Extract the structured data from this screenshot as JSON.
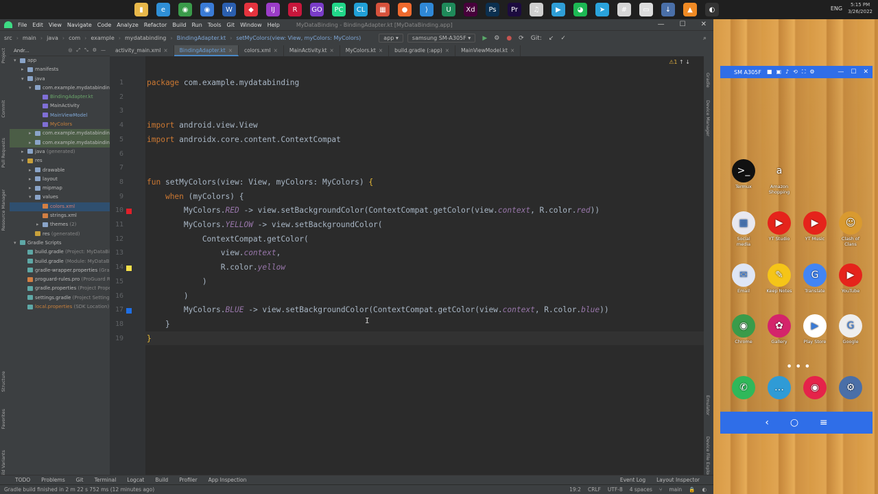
{
  "taskbar": {
    "icons": [
      {
        "name": "folder-icon",
        "color": "#e8b84a",
        "glyph": "▮"
      },
      {
        "name": "edge-icon",
        "color": "#2f8fd6",
        "glyph": "e"
      },
      {
        "name": "chrome-icon",
        "color": "#3a9b4a",
        "glyph": "◉"
      },
      {
        "name": "chrome-beta-icon",
        "color": "#3a7bd6",
        "glyph": "◉"
      },
      {
        "name": "word-icon",
        "color": "#2b5fb0",
        "glyph": "W"
      },
      {
        "name": "app-red-icon",
        "color": "#e5333e",
        "glyph": "◆"
      },
      {
        "name": "intellij-icon",
        "color": "#9b3cc8",
        "glyph": "IJ"
      },
      {
        "name": "rider-icon",
        "color": "#c8173c",
        "glyph": "R"
      },
      {
        "name": "goland-icon",
        "color": "#7a3cc8",
        "glyph": "GO"
      },
      {
        "name": "pycharm-icon",
        "color": "#21d789",
        "glyph": "PC"
      },
      {
        "name": "clion-icon",
        "color": "#21a0d7",
        "glyph": "CL"
      },
      {
        "name": "photos-icon",
        "color": "#d7523c",
        "glyph": "▦"
      },
      {
        "name": "postman-icon",
        "color": "#f06a2e",
        "glyph": "●"
      },
      {
        "name": "vscode-icon",
        "color": "#2f88d6",
        "glyph": "⟩"
      },
      {
        "name": "upwork-icon",
        "color": "#1f8a5a",
        "glyph": "U"
      },
      {
        "name": "xd-icon",
        "color": "#47003b",
        "glyph": "Xd"
      },
      {
        "name": "photoshop-icon",
        "color": "#0b2f4f",
        "glyph": "Ps"
      },
      {
        "name": "premiere-icon",
        "color": "#1c0b3f",
        "glyph": "Pr"
      },
      {
        "name": "itunes-icon",
        "color": "#cfcfcf",
        "glyph": "♫"
      },
      {
        "name": "media-player-icon",
        "color": "#2f9ed6",
        "glyph": "▶"
      },
      {
        "name": "spotify-icon",
        "color": "#1db954",
        "glyph": "◕"
      },
      {
        "name": "telegram-icon",
        "color": "#2aa3dc",
        "glyph": "➤"
      },
      {
        "name": "slack-icon",
        "color": "#d6d6d6",
        "glyph": "#"
      },
      {
        "name": "photos-viewer-icon",
        "color": "#dcdcdc",
        "glyph": "▭"
      },
      {
        "name": "download-icon",
        "color": "#4a6fa8",
        "glyph": "↓"
      },
      {
        "name": "vlc-icon",
        "color": "#f08a24",
        "glyph": "▲"
      },
      {
        "name": "obs-icon",
        "color": "#333333",
        "glyph": "◐"
      }
    ],
    "lang": "ENG",
    "time": "5:15 PM",
    "date": "3/26/2022"
  },
  "menu": {
    "items": [
      "File",
      "Edit",
      "View",
      "Navigate",
      "Code",
      "Analyze",
      "Refactor",
      "Build",
      "Run",
      "Tools",
      "Git",
      "Window",
      "Help"
    ],
    "window_title": "MyDataBinding - BindingAdapter.kt [MyDataBinding.app]"
  },
  "nav": {
    "breadcrumbs": [
      "src",
      "main",
      "java",
      "com",
      "example",
      "mydatabinding",
      "BindingAdapter.kt",
      "setMyColors(view: View, myColors: MyColors)"
    ],
    "run_config": "app",
    "device": "samsung SM-A305F",
    "git_label": "Git:"
  },
  "tabs": [
    {
      "label": "activity_main.xml",
      "active": false
    },
    {
      "label": "BindingAdapter.kt",
      "active": true
    },
    {
      "label": "colors.xml",
      "active": false
    },
    {
      "label": "MainActivity.kt",
      "active": false
    },
    {
      "label": "MyColors.kt",
      "active": false
    },
    {
      "label": "build.gradle (:app)",
      "active": false
    },
    {
      "label": "MainViewModel.kt",
      "active": false
    }
  ],
  "project": {
    "header": "Andr...",
    "tree": [
      {
        "indent": 0,
        "arrow": "▾",
        "icon": "folder",
        "label": "app",
        "extra": "",
        "cls": ""
      },
      {
        "indent": 1,
        "arrow": "▸",
        "icon": "folder",
        "label": "manifests",
        "extra": "",
        "cls": ""
      },
      {
        "indent": 1,
        "arrow": "▾",
        "icon": "folder",
        "label": "java",
        "extra": "",
        "cls": ""
      },
      {
        "indent": 2,
        "arrow": "▾",
        "icon": "folder",
        "label": "com.example.mydatabinding",
        "extra": "",
        "cls": ""
      },
      {
        "indent": 3,
        "arrow": "",
        "icon": "kt",
        "label": "BindingAdapter.kt",
        "extra": "",
        "cls": "green"
      },
      {
        "indent": 3,
        "arrow": "",
        "icon": "kt",
        "label": "MainActivity",
        "extra": "",
        "cls": ""
      },
      {
        "indent": 3,
        "arrow": "",
        "icon": "kt",
        "label": "MainViewModel",
        "extra": "",
        "cls": "blue"
      },
      {
        "indent": 3,
        "arrow": "",
        "icon": "kt",
        "label": "MyColors",
        "extra": "",
        "cls": "orange"
      },
      {
        "indent": 2,
        "arrow": "▸",
        "icon": "folder",
        "label": "com.example.mydatabinding",
        "extra": "",
        "cls": "",
        "hl": true
      },
      {
        "indent": 2,
        "arrow": "▸",
        "icon": "folder",
        "label": "com.example.mydatabinding",
        "extra": "",
        "cls": "",
        "hl": true
      },
      {
        "indent": 1,
        "arrow": "▸",
        "icon": "folder",
        "label": "java",
        "extra": "(generated)",
        "cls": ""
      },
      {
        "indent": 1,
        "arrow": "▾",
        "icon": "res",
        "label": "res",
        "extra": "",
        "cls": ""
      },
      {
        "indent": 2,
        "arrow": "▸",
        "icon": "folder",
        "label": "drawable",
        "extra": "",
        "cls": ""
      },
      {
        "indent": 2,
        "arrow": "▸",
        "icon": "folder",
        "label": "layout",
        "extra": "",
        "cls": ""
      },
      {
        "indent": 2,
        "arrow": "▸",
        "icon": "folder",
        "label": "mipmap",
        "extra": "",
        "cls": ""
      },
      {
        "indent": 2,
        "arrow": "▾",
        "icon": "folder",
        "label": "values",
        "extra": "",
        "cls": ""
      },
      {
        "indent": 3,
        "arrow": "",
        "icon": "xml",
        "label": "colors.xml",
        "extra": "",
        "cls": "red",
        "sel": true
      },
      {
        "indent": 3,
        "arrow": "",
        "icon": "xml",
        "label": "strings.xml",
        "extra": "",
        "cls": ""
      },
      {
        "indent": 3,
        "arrow": "▸",
        "icon": "folder",
        "label": "themes",
        "extra": "(2)",
        "cls": ""
      },
      {
        "indent": 2,
        "arrow": "",
        "icon": "res",
        "label": "res",
        "extra": "(generated)",
        "cls": ""
      },
      {
        "indent": 0,
        "arrow": "▾",
        "icon": "gradle",
        "label": "Gradle Scripts",
        "extra": "",
        "cls": ""
      },
      {
        "indent": 1,
        "arrow": "",
        "icon": "gradle",
        "label": "build.gradle",
        "extra": "(Project: MyDataBinding)",
        "cls": ""
      },
      {
        "indent": 1,
        "arrow": "",
        "icon": "gradle",
        "label": "build.gradle",
        "extra": "(Module: MyDataBinding.app)",
        "cls": ""
      },
      {
        "indent": 1,
        "arrow": "",
        "icon": "gradle",
        "label": "gradle-wrapper.properties",
        "extra": "(Gradle Version)",
        "cls": ""
      },
      {
        "indent": 1,
        "arrow": "",
        "icon": "xml",
        "label": "proguard-rules.pro",
        "extra": "(ProGuard Rules)",
        "cls": ""
      },
      {
        "indent": 1,
        "arrow": "",
        "icon": "gradle",
        "label": "gradle.properties",
        "extra": "(Project Properties)",
        "cls": ""
      },
      {
        "indent": 1,
        "arrow": "",
        "icon": "gradle",
        "label": "settings.gradle",
        "extra": "(Project Settings)",
        "cls": ""
      },
      {
        "indent": 1,
        "arrow": "",
        "icon": "gradle",
        "label": "local.properties",
        "extra": "(SDK Location)",
        "cls": "orange"
      }
    ]
  },
  "left_strip_labels": [
    "Project",
    "Commit",
    "Pull Requests",
    "Resource Manager",
    "Structure",
    "Favorites",
    "Build Variants"
  ],
  "right_strip_labels": [
    "Gradle",
    "Device Manager",
    "Emulator",
    "Device File Explorer"
  ],
  "editor": {
    "inspection": "⚠1",
    "lines": [
      {
        "n": "1",
        "html": "<span class=\"kw\">package</span> com.example.mydatabinding"
      },
      {
        "n": "2",
        "html": ""
      },
      {
        "n": "3",
        "html": ""
      },
      {
        "n": "4",
        "html": "<span class=\"kw\">import</span> android.view.View"
      },
      {
        "n": "5",
        "html": "<span class=\"kw\">import</span> androidx.core.content.ContextCompat"
      },
      {
        "n": "6",
        "html": ""
      },
      {
        "n": "7",
        "html": ""
      },
      {
        "n": "8",
        "html": "<span class=\"kw\">fun</span> <span class=\"fnu\">setMyColors</span>(view: View, myColors: MyColors) <span class=\"brace\">{</span>"
      },
      {
        "n": "9",
        "html": "    <span class=\"kw\">when</span> (myColors) {"
      },
      {
        "n": "10",
        "html": "        MyColors.<span class=\"it\">RED</span> -> view.setBackgroundColor(ContextCompat.getColor(view.<span class=\"it\">context</span>, R.color.<span class=\"it\">red</span>))"
      },
      {
        "n": "11",
        "html": "        MyColors.<span class=\"it\">YELLOW</span> -> view.setBackgroundColor("
      },
      {
        "n": "12",
        "html": "            ContextCompat.getColor("
      },
      {
        "n": "13",
        "html": "                view.<span class=\"it\">context</span>,"
      },
      {
        "n": "14",
        "html": "                R.color.<span class=\"it\">yellow</span>"
      },
      {
        "n": "15",
        "html": "            )"
      },
      {
        "n": "16",
        "html": "        )"
      },
      {
        "n": "17",
        "html": "        MyColors.<span class=\"it\">BLUE</span> -> view.setBackgroundColor(ContextCompat.getColor(view.<span class=\"it\">context</span>, R.color.<span class=\"it\">blue</span>))"
      },
      {
        "n": "18",
        "html": "    }"
      },
      {
        "n": "19",
        "html": "<span class=\"brace\">}</span>"
      }
    ],
    "gutter_marks": [
      {
        "line": "10",
        "color": "#e0202a"
      },
      {
        "line": "14",
        "color": "#f5e04a"
      },
      {
        "line": "17",
        "color": "#1f6fe5"
      }
    ]
  },
  "bottom_tools": {
    "left": [
      "TODO",
      "Problems",
      "Git",
      "Terminal",
      "Logcat",
      "Build",
      "Profiler",
      "App Inspection"
    ],
    "right": [
      "Event Log",
      "Layout Inspector"
    ]
  },
  "status": {
    "message": "Gradle build finished in 2 m 22 s 752 ms (12 minutes ago)",
    "position": "19:2",
    "line_sep": "CRLF",
    "encoding": "UTF-8",
    "indent": "4 spaces",
    "branch": "main"
  },
  "emulator": {
    "title": "SM A305F",
    "apps": [
      {
        "label": "Termux",
        "color": "#111111",
        "glyph": ">_"
      },
      {
        "label": "Amazon Shopping",
        "color": "transparent",
        "glyph": "a"
      },
      {
        "label": "Social media",
        "color": "#e8e8f0",
        "glyph": "▦"
      },
      {
        "label": "YT Studio",
        "color": "#e5231b",
        "glyph": "▶"
      },
      {
        "label": "YT Music",
        "color": "#e5231b",
        "glyph": "▶"
      },
      {
        "label": "Clash of Clans",
        "color": "#d99a30",
        "glyph": "☺"
      },
      {
        "label": "Email",
        "color": "#dfe6f5",
        "glyph": "✉"
      },
      {
        "label": "Keep Notes",
        "color": "#f5c518",
        "glyph": "✎"
      },
      {
        "label": "Translate",
        "color": "#4285f4",
        "glyph": "G"
      },
      {
        "label": "YouTube",
        "color": "#e5231b",
        "glyph": "▶"
      },
      {
        "label": "Chrome",
        "color": "#3a9b4a",
        "glyph": "◉"
      },
      {
        "label": "Gallery",
        "color": "#d4246b",
        "glyph": "✿"
      },
      {
        "label": "Play Store",
        "color": "#ffffff",
        "glyph": "▶"
      },
      {
        "label": "Google",
        "color": "#eeeeee",
        "glyph": "G"
      }
    ],
    "dock": [
      {
        "label": "",
        "color": "#2fb85a",
        "glyph": "✆"
      },
      {
        "label": "",
        "color": "#2f9bd6",
        "glyph": "…"
      },
      {
        "label": "",
        "color": "#e5234a",
        "glyph": "◉"
      },
      {
        "label": "",
        "color": "#4a6fa8",
        "glyph": "⚙"
      }
    ],
    "nav": [
      "‹",
      "○",
      "≡"
    ]
  }
}
